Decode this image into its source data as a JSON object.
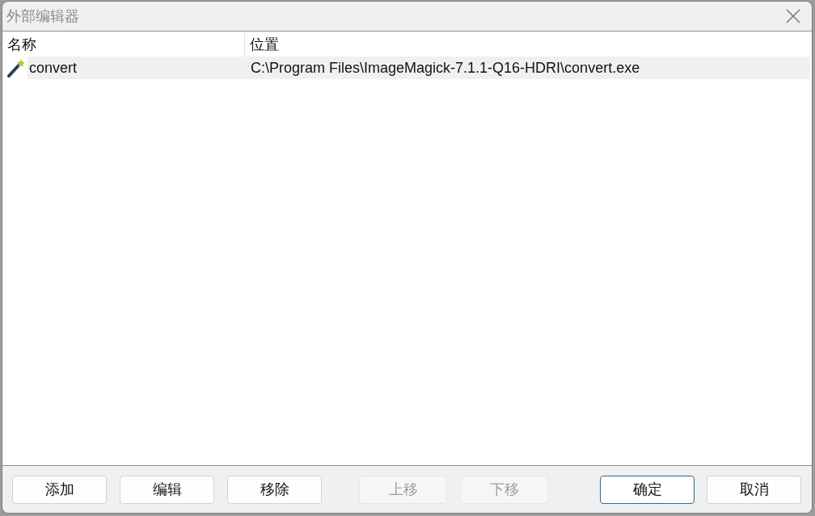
{
  "window": {
    "title": "外部编辑器"
  },
  "table": {
    "columns": [
      "名称",
      "位置"
    ],
    "rows": [
      {
        "name": "convert",
        "location": "C:\\Program Files\\ImageMagick-7.1.1-Q16-HDRI\\convert.exe",
        "selected": true
      }
    ]
  },
  "footer": {
    "edit_buttons": [
      {
        "label": "添加",
        "disabled": false,
        "default": false
      },
      {
        "label": "编辑",
        "disabled": false,
        "default": false
      },
      {
        "label": "移除",
        "disabled": false,
        "default": false
      }
    ],
    "order_buttons": [
      {
        "label": "上移",
        "disabled": true,
        "default": false
      },
      {
        "label": "下移",
        "disabled": true,
        "default": false
      }
    ],
    "dialog_buttons": [
      {
        "label": "确定",
        "disabled": false,
        "default": true
      },
      {
        "label": "取消",
        "disabled": false,
        "default": false
      }
    ]
  }
}
